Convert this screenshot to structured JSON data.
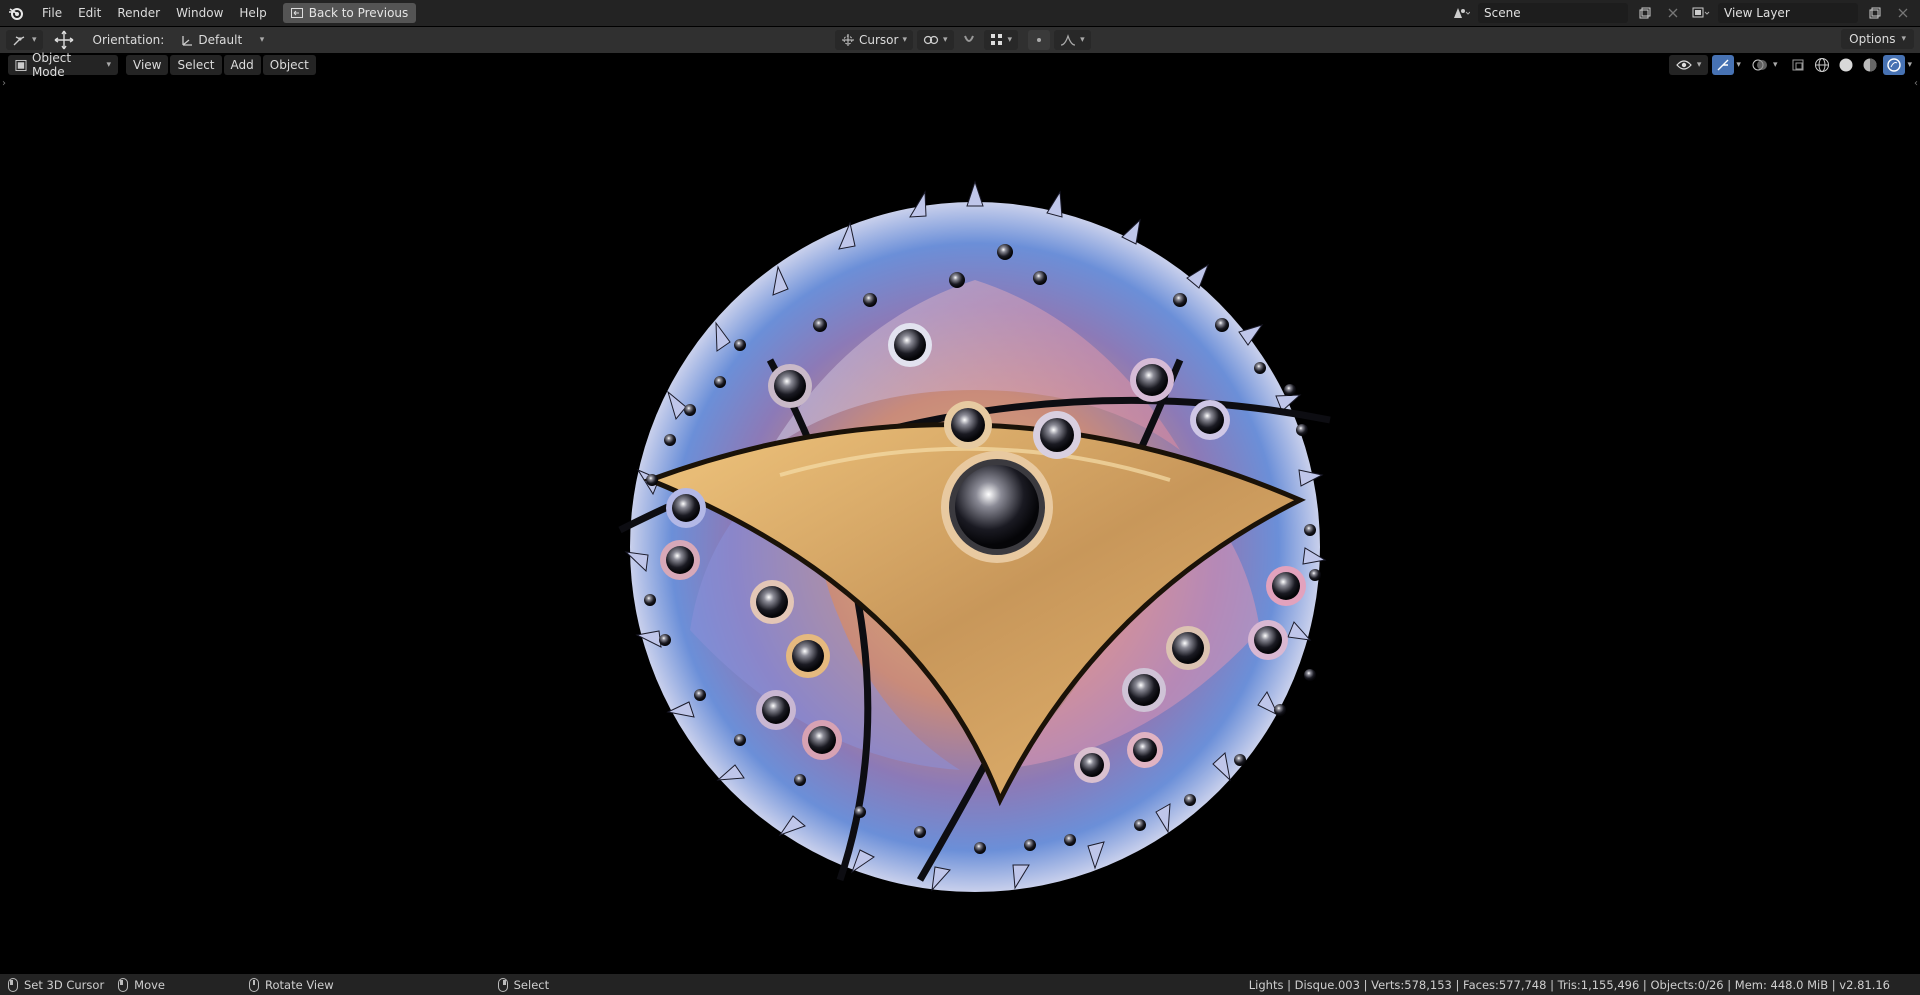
{
  "menu": {
    "items": [
      "File",
      "Edit",
      "Render",
      "Window",
      "Help"
    ],
    "back_button": "Back to Previous"
  },
  "scene": {
    "value": "Scene"
  },
  "view_layer": {
    "value": "View Layer"
  },
  "toolbar": {
    "orientation_label": "Orientation:",
    "orientation_value": "Default",
    "pivot_value": "Cursor"
  },
  "viewport_header": {
    "mode": "Object Mode",
    "view": "View",
    "select": "Select",
    "add": "Add",
    "object": "Object",
    "options": "Options"
  },
  "statusbar": {
    "hint1": "Set 3D Cursor",
    "hint2": "Move",
    "hint3": "Rotate View",
    "hint4": "Select",
    "stats": "Lights | Disque.003 | Verts:578,153 | Faces:577,748 | Tris:1,155,496 | Objects:0/26 | Mem: 448.0 MiB | v2.81.16"
  },
  "colors": {
    "topbar": "#232323",
    "toolbar": "#303030",
    "viewport": "#000000",
    "accent": "#4772b3"
  }
}
